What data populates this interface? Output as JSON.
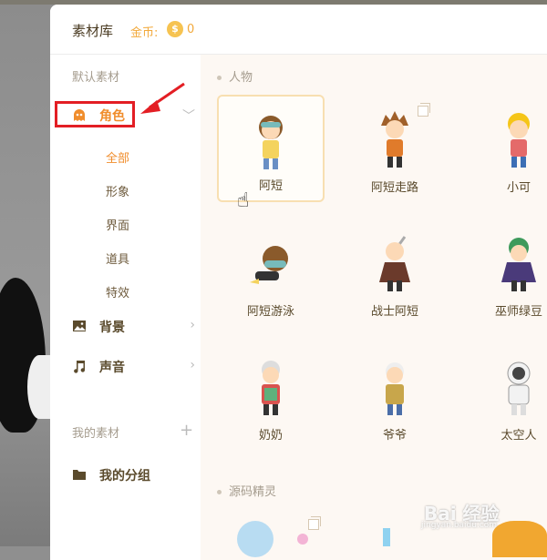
{
  "header": {
    "title": "素材库",
    "coins_label": "金币:",
    "coin_symbol": "$",
    "coins_value": "0"
  },
  "sidebar": {
    "default_section": "默认素材",
    "items": [
      {
        "label": "角色",
        "sub_items": [
          "全部",
          "形象",
          "界面",
          "道具",
          "特效"
        ]
      },
      {
        "label": "背景"
      },
      {
        "label": "声音"
      }
    ],
    "my_section": "我的素材",
    "my_group": "我的分组"
  },
  "content": {
    "groups": [
      {
        "label": "人物",
        "cards": [
          {
            "name": "阿短"
          },
          {
            "name": "阿短走路"
          },
          {
            "name": "小可"
          },
          {
            "name": "阿短游泳"
          },
          {
            "name": "战士阿短"
          },
          {
            "name": "巫师绿豆"
          },
          {
            "name": "奶奶"
          },
          {
            "name": "爷爷"
          },
          {
            "name": "太空人"
          }
        ]
      },
      {
        "label": "源码精灵"
      }
    ]
  },
  "watermark": {
    "text": "Bai 经验",
    "sub": "jingyan.baidu.com"
  },
  "colors": {
    "accent": "#f08d2c",
    "highlight": "#e31e24",
    "text": "#5a4a2c"
  }
}
